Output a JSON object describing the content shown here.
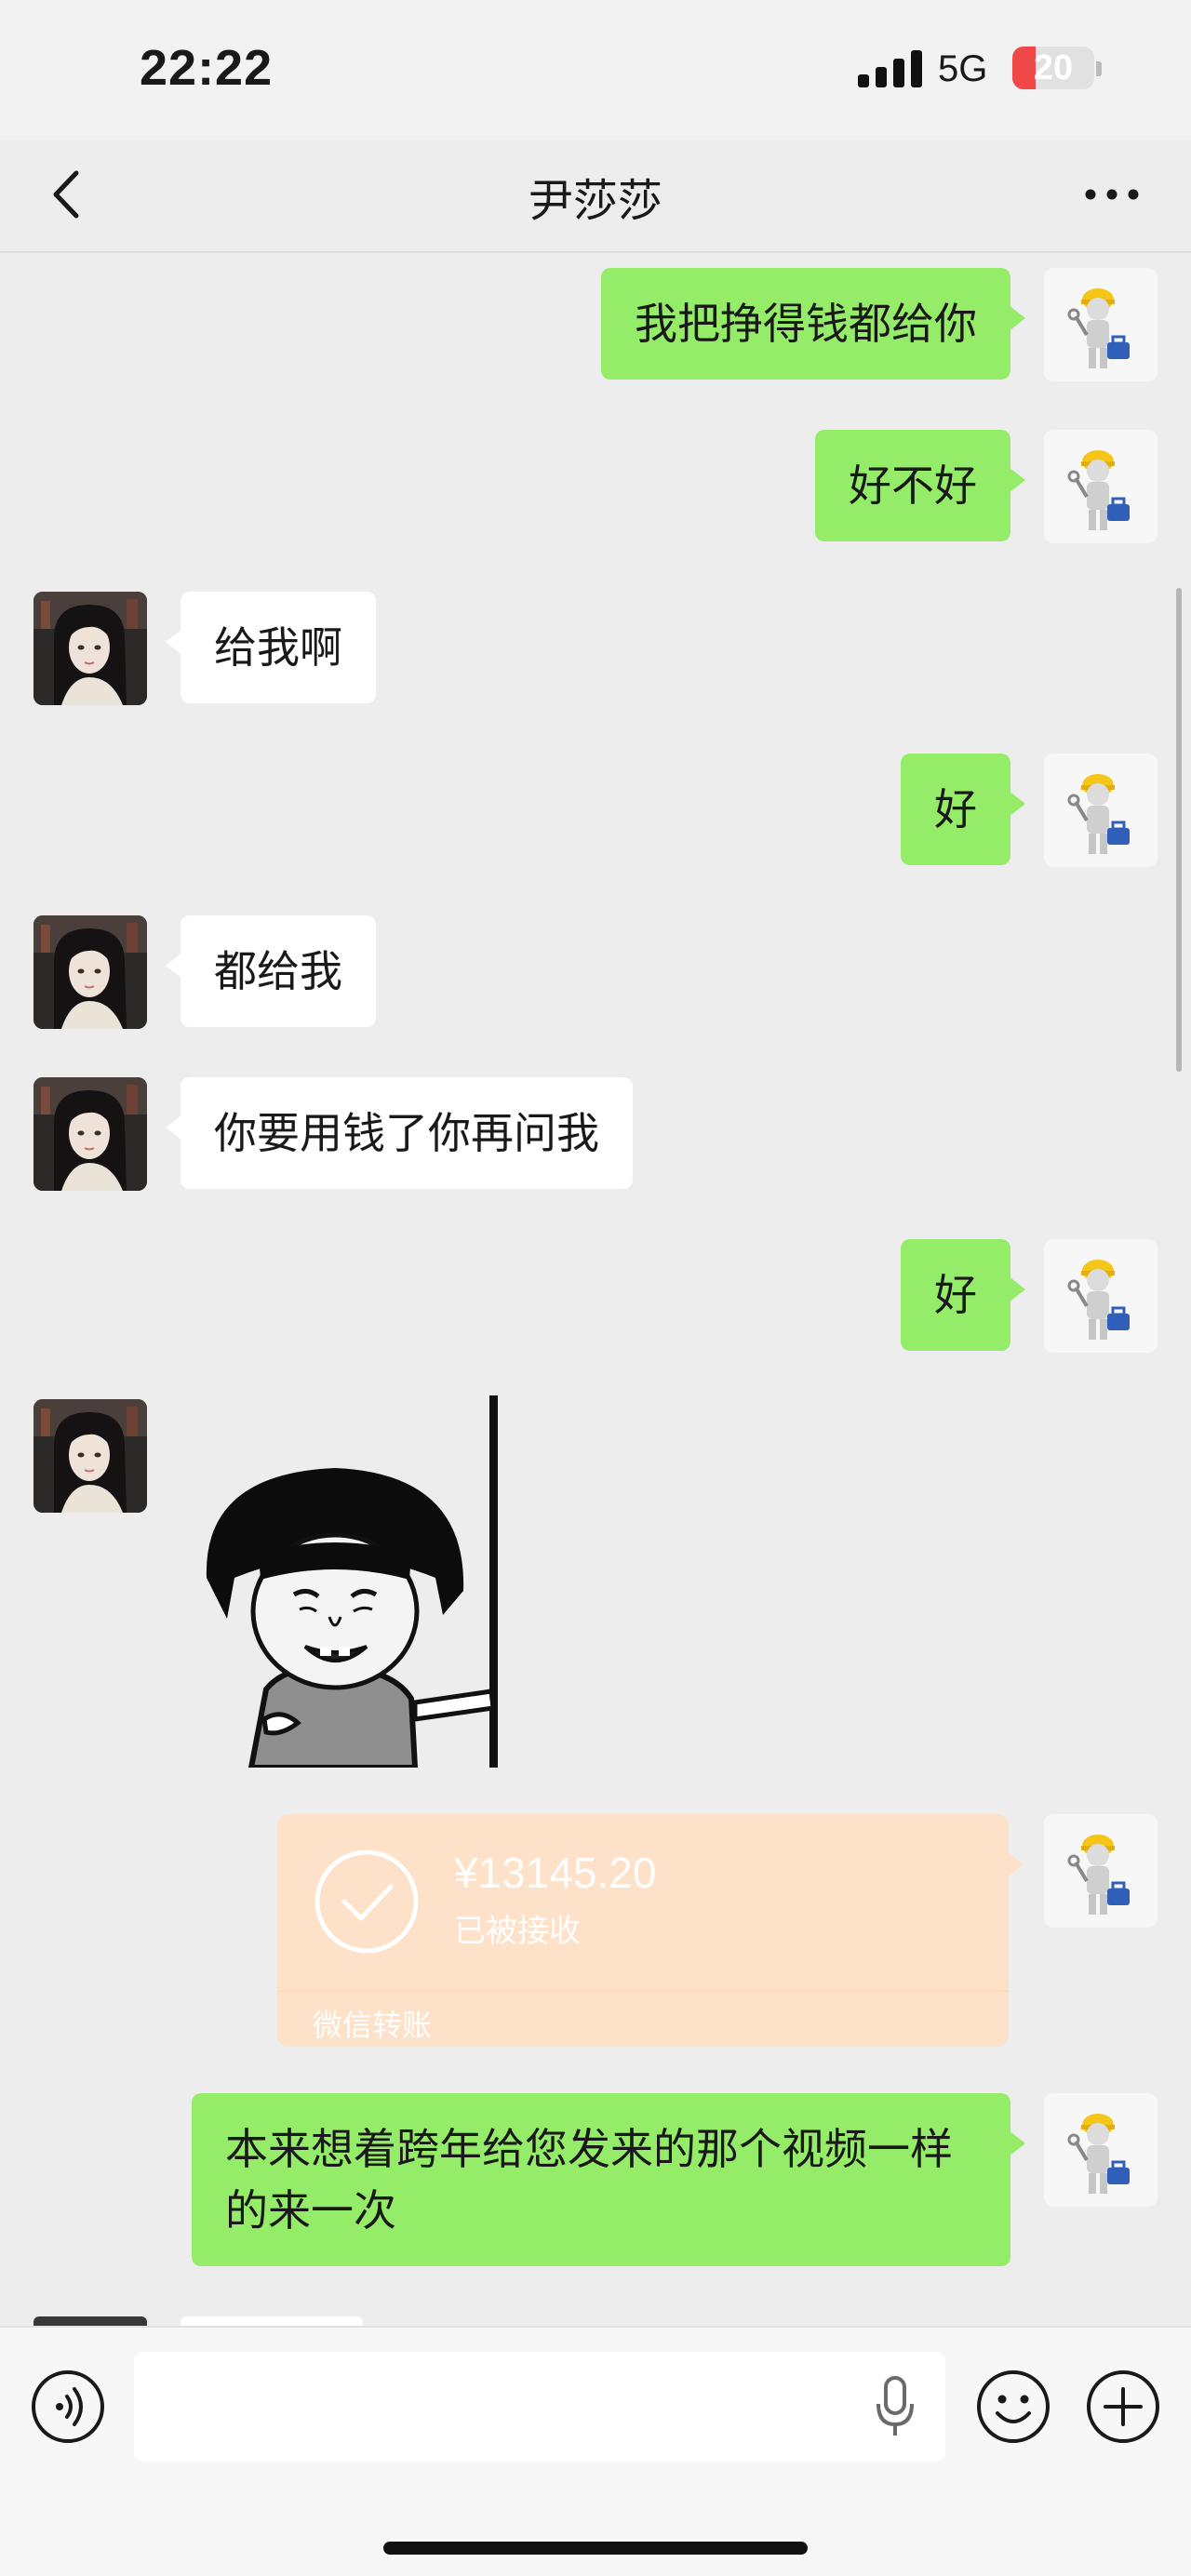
{
  "status_bar": {
    "time": "22:22",
    "network": "5G",
    "battery_level": "20"
  },
  "nav": {
    "title": "尹莎莎",
    "back_icon": "chevron-left-icon",
    "more_icon": "more-dots-icon"
  },
  "messages": [
    {
      "side": "right",
      "text": "我把挣得钱都给你"
    },
    {
      "side": "right",
      "text": "好不好"
    },
    {
      "side": "left",
      "text": "给我啊"
    },
    {
      "side": "right",
      "text": "好"
    },
    {
      "side": "left",
      "text": "都给我"
    },
    {
      "side": "left",
      "text": "你要用钱了你再问我"
    },
    {
      "side": "right",
      "text": "好"
    },
    {
      "side": "left",
      "type": "sticker",
      "description_icon": "bowl-cut-meme-sticker"
    },
    {
      "side": "right",
      "type": "transfer"
    },
    {
      "side": "right",
      "text": "本来想着跨年给您发来的那个视频一样的来一次"
    }
  ],
  "transfer": {
    "amount": "¥13145.20",
    "status": "已被接收",
    "label": "微信转账"
  },
  "input_bar": {
    "voice_icon": "voice-icon",
    "mic_icon": "microphone-icon",
    "emoji_icon": "emoji-icon",
    "plus_icon": "plus-icon",
    "value": ""
  },
  "colors": {
    "sent_bubble": "#95ec69",
    "received_bubble": "#ffffff",
    "background": "#ededed",
    "transfer_card": "#fde1c8"
  }
}
